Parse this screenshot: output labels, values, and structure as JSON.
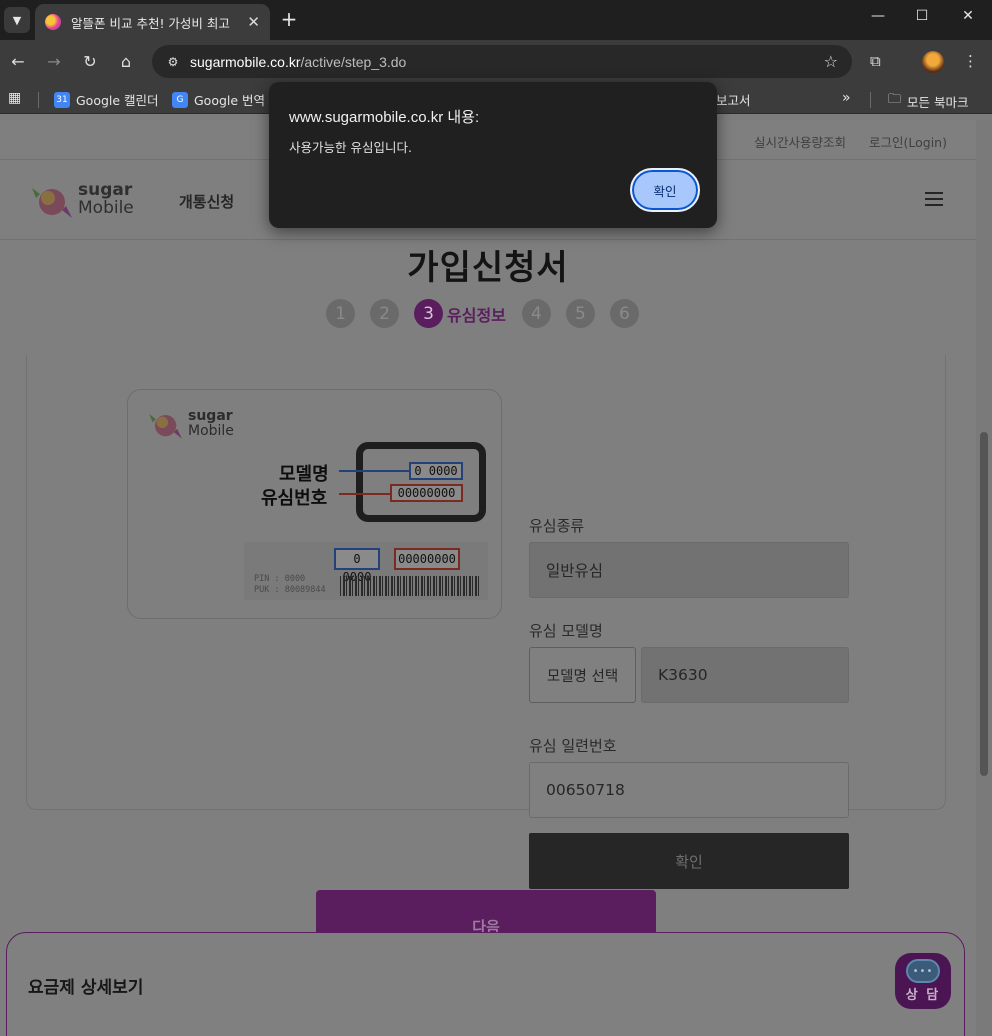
{
  "browser": {
    "tab_title": "알뜰폰 비교 추천! 가성비 최고",
    "url_host": "sugarmobile.co.kr",
    "url_path": "/active/step_3.do",
    "bookmarks": [
      {
        "label": "Google 캘린더",
        "icon": "calendar-icon",
        "color": "#4285f4"
      },
      {
        "label": "Google 번역",
        "icon": "translate-icon",
        "color": "#4285f4"
      },
      {
        "label": ".보고서",
        "icon": "",
        "color": ""
      },
      {
        "label": "모든 북마크",
        "icon": "folder-icon",
        "color": ""
      }
    ],
    "overflow_label": "»"
  },
  "site": {
    "util_links": [
      "실시간사용량조회",
      "로그인(Login)"
    ],
    "logo_line1": "sugar",
    "logo_line2": "Mobile",
    "nav_item": "개통신청",
    "page_title": "가입신청서",
    "steps": [
      "1",
      "2",
      "3",
      "4",
      "5",
      "6"
    ],
    "active_step": "3",
    "active_step_label": "유심정보",
    "accent_color": "#a63bb0"
  },
  "sim_illustration": {
    "logo_line1": "sugar",
    "logo_line2": "Mobile",
    "label_model": "모델명",
    "label_serial": "유심번호",
    "model_box": "0 0000",
    "serial_box": "00000000",
    "barcode_model": "0 0000",
    "barcode_serial": "00000000",
    "pin": "PIN  : 0000",
    "puk": "PUK : 80089844"
  },
  "form": {
    "sim_type_label": "유심종류",
    "sim_type_value": "일반유심",
    "model_label": "유심 모델명",
    "model_select_label": "모델명 선택",
    "model_value": "K3630",
    "serial_label": "유심 일련번호",
    "serial_value": "00650718",
    "confirm_label": "확인",
    "next_label": "다음"
  },
  "plan_panel": {
    "title": "요금제 상세보기",
    "chat_label": "상 담",
    "chat_bubble": "•••"
  },
  "dialog": {
    "title": "www.sugarmobile.co.kr 내용:",
    "message": "사용가능한 유심입니다.",
    "ok_label": "확인"
  }
}
